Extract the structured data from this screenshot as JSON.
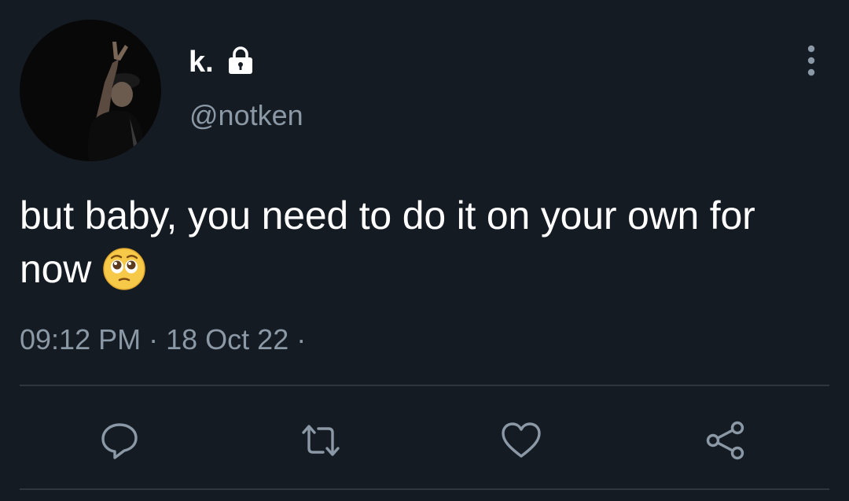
{
  "tweet": {
    "display_name": "k.",
    "handle": "@notken",
    "text_line1": "but baby, you need to do it on your own for",
    "text_line2": "now",
    "time": "09:12 PM",
    "separator": "·",
    "date": "18 Oct 22",
    "trailing_separator": "·"
  },
  "icons": {
    "lock": "lock-icon",
    "more": "more-vertical-icon",
    "emoji": "pleading-face-emoji",
    "reply": "reply-icon",
    "retweet": "retweet-icon",
    "like": "heart-icon",
    "share": "share-icon"
  },
  "colors": {
    "background": "#151b23",
    "primary_text": "#ffffff",
    "secondary_text": "#8b98a5",
    "icon": "#8b98a5",
    "divider": "#2f3640"
  }
}
